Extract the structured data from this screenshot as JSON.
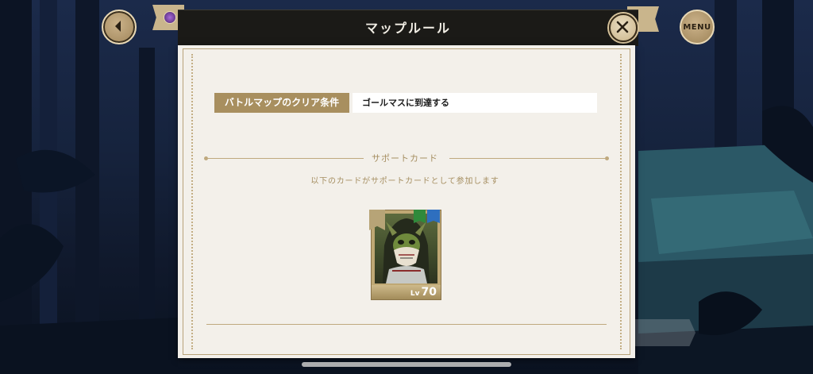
{
  "header": {
    "title": "マップルール",
    "menu_label": "MENU"
  },
  "condition": {
    "label": "バトルマップのクリア条件",
    "value": "ゴールマスに到達する"
  },
  "support": {
    "title": "サポートカード",
    "description": "以下のカードがサポートカードとして参加します",
    "card": {
      "lv_label": "Lv",
      "level": "70"
    }
  },
  "colors": {
    "accent": "#a88f5f",
    "modal_bg": "#f3f0ea",
    "header_bg": "#1b1a17"
  }
}
